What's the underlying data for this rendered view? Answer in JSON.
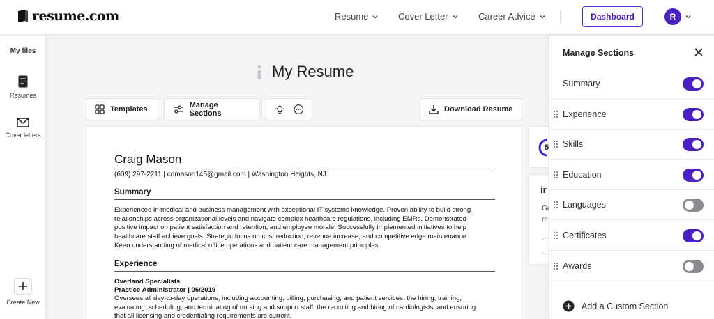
{
  "header": {
    "logo_text": "resume.com",
    "nav": [
      {
        "label": "Resume"
      },
      {
        "label": "Cover Letter"
      },
      {
        "label": "Career Advice"
      }
    ],
    "dashboard_label": "Dashboard",
    "avatar_initial": "R"
  },
  "sidebar": {
    "heading": "My files",
    "items": [
      {
        "label": "Resumes",
        "icon": "document-icon"
      },
      {
        "label": "Cover letters",
        "icon": "envelope-icon"
      }
    ],
    "create_label": "Create New"
  },
  "main": {
    "title": "My Resume",
    "toolbar": {
      "templates": "Templates",
      "manage_sections": "Manage Sections",
      "download": "Download Resume"
    }
  },
  "resume": {
    "name": "Craig Mason",
    "contact": "(609) 297-2211 | cdmason145@gmail.com | Washington Heights, NJ",
    "summary_heading": "Summary",
    "summary_lines": [
      "Experienced in medical and business management with exceptional IT systems knowledge. Proven ability to build strong",
      "relationships across organizational levels and navigate complex healthcare regulations, including EMRs. Demonstrated",
      "positive impact on patient satisfaction and retention, and employee morale. Successfully implemented initiatives to help",
      "healthcare staff achieve goals. Strategic focus on cost reduction, revenue increase, and competitive edge maintenance.",
      "Keen understanding of medical office operations and patient care management principles."
    ],
    "experience_heading": "Experience",
    "company": "Overland Specialists",
    "role": "Practice Administrator | 06/2019",
    "experience_lines": [
      "Oversees all day-to-day operations, including accounting, billing, purchasing, and patient services, the hiring, training,",
      "evaluating, scheduling, and terminating of nursing and support staff, the recruiting and hiring of cardiologists, and ensuring",
      "that all licensing and credentialing requirements are current."
    ]
  },
  "side_card": {
    "score_fragment": "5",
    "tips_fragment": "ir",
    "line1_fragment": "Ge",
    "line2_fragment": "re"
  },
  "panel": {
    "title": "Manage Sections",
    "sections": [
      {
        "label": "Summary",
        "enabled": true,
        "draggable": false
      },
      {
        "label": "Experience",
        "enabled": true,
        "draggable": true
      },
      {
        "label": "Skills",
        "enabled": true,
        "draggable": true
      },
      {
        "label": "Education",
        "enabled": true,
        "draggable": true
      },
      {
        "label": "Languages",
        "enabled": false,
        "draggable": true
      },
      {
        "label": "Certificates",
        "enabled": true,
        "draggable": true
      },
      {
        "label": "Awards",
        "enabled": false,
        "draggable": true
      }
    ],
    "add_label": "Add a Custom Section"
  },
  "colors": {
    "accent": "#4a1fc4",
    "toggle_off": "#8a8a90"
  }
}
